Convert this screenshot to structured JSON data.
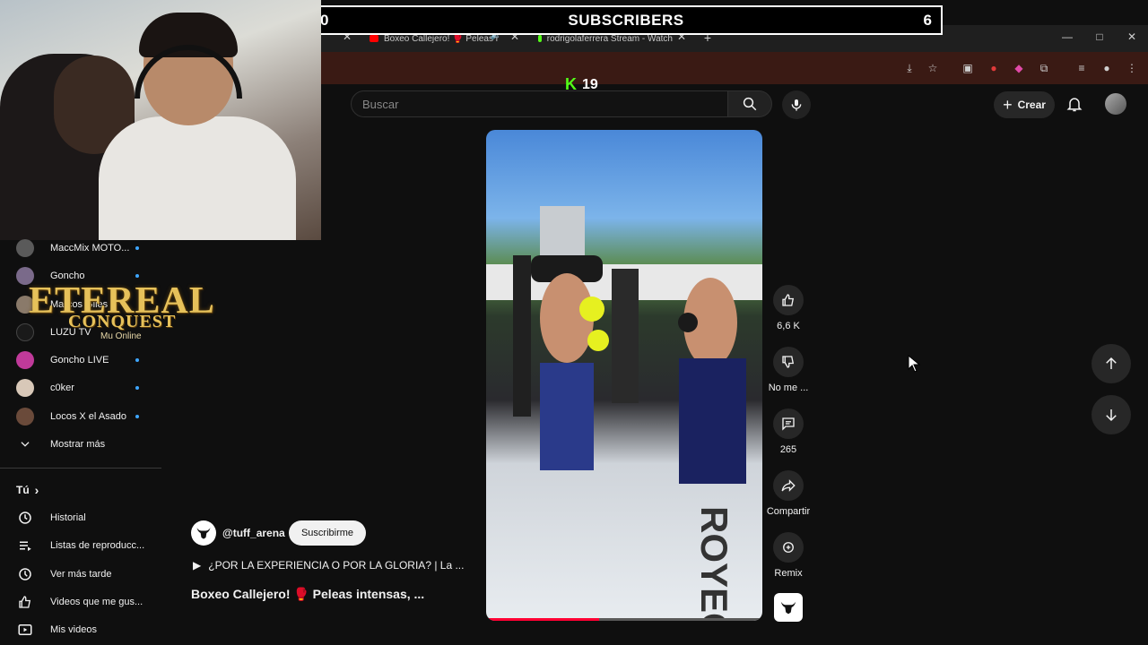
{
  "overlay": {
    "subscribers": {
      "left_count": "0",
      "title": "SUBSCRIBERS",
      "right_count": "6"
    },
    "kick": {
      "count": "19"
    },
    "logo": {
      "line1": "ETEREAL",
      "line2": "CONQUEST",
      "line3": "Mu Online"
    }
  },
  "browser": {
    "tabs": [
      {
        "label": "Boxeo Callejero! 🥊 Peleas i"
      },
      {
        "label": "rodrigolaferrera Stream - Watch"
      }
    ],
    "new_tab": "+",
    "window_controls": {
      "minimize": "—",
      "maximize": "□",
      "close": "✕"
    }
  },
  "header": {
    "search_placeholder": "Buscar",
    "create_label": "Crear"
  },
  "sidebar": {
    "subscriptions": [
      {
        "label": "MaccMix MOTO...",
        "color": "#5a5a5a"
      },
      {
        "label": "Goncho",
        "color": "#7a6a8a"
      },
      {
        "label": "Marcos Giles",
        "color": "#8a7a6a"
      },
      {
        "label": "LUZU TV",
        "color": "#1a1a1a"
      },
      {
        "label": "Goncho LIVE",
        "color": "#c03a9a"
      },
      {
        "label": "c0ker",
        "color": "#d8c8b8"
      },
      {
        "label": "Locos X el Asado",
        "color": "#6a4a3a"
      }
    ],
    "show_more": "Mostrar más",
    "you_section": "Tú",
    "you_items": [
      {
        "label": "Historial",
        "icon": "history-icon"
      },
      {
        "label": "Listas de reproducc...",
        "icon": "playlist-icon"
      },
      {
        "label": "Ver más tarde",
        "icon": "clock-icon"
      },
      {
        "label": "Videos que me gus...",
        "icon": "like-icon"
      },
      {
        "label": "Mis videos",
        "icon": "video-icon"
      }
    ]
  },
  "short": {
    "channel": "@tuff_arena",
    "subscribe_label": "Suscribirme",
    "playlist_text": "¿POR LA EXPERIENCIA O POR LA GLORIA? | La ...",
    "title": "Boxeo Callejero! 🥊 Peleas intensas, ...",
    "progress": 0.41,
    "actions": {
      "likes": "6,6 K",
      "dislike": "No me ...",
      "comments": "265",
      "share": "Compartir",
      "remix": "Remix"
    }
  },
  "colors": {
    "accent_red": "#ff0033",
    "kick_green": "#53fc18",
    "link_blue": "#3ea6ff"
  }
}
